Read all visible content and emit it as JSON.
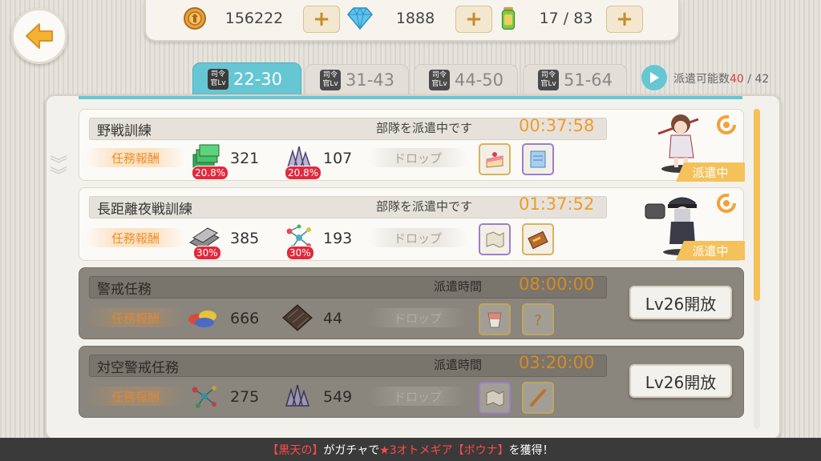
{
  "resources": [
    {
      "icon": "coin-icon",
      "value": "156222"
    },
    {
      "icon": "diamond-icon",
      "value": "1888"
    },
    {
      "icon": "stamina-icon",
      "value": "17 / 83"
    }
  ],
  "plus_label": "+",
  "tabs": [
    {
      "badge_top": "司令",
      "badge_bottom": "官Lv",
      "range": "22-30",
      "active": true
    },
    {
      "badge_top": "司令",
      "badge_bottom": "官Lv",
      "range": "31-43",
      "active": false
    },
    {
      "badge_top": "司令",
      "badge_bottom": "官Lv",
      "range": "44-50",
      "active": false
    },
    {
      "badge_top": "司令",
      "badge_bottom": "官Lv",
      "range": "51-64",
      "active": false
    }
  ],
  "dispatch": {
    "label": "派遣可能数",
    "current": "40",
    "total": " / 42"
  },
  "labels": {
    "reward": "任務報酬",
    "drop": "ドロップ"
  },
  "missions": [
    {
      "name": "野戦訓練",
      "status": "部隊を派遣中です",
      "time": "00:37:58",
      "rewards": [
        {
          "icon": "green-cash-icon",
          "value": "321",
          "bonus": "20.8%"
        },
        {
          "icon": "crystal-icon",
          "value": "107",
          "bonus": "20.8%"
        }
      ],
      "drops": [
        {
          "icon": "cake-icon"
        },
        {
          "icon": "scroll-icon"
        }
      ],
      "state": "派遣中"
    },
    {
      "name": "長距離夜戦訓練",
      "status": "部隊を派遣中です",
      "time": "01:37:52",
      "rewards": [
        {
          "icon": "steel-plate-icon",
          "value": "385",
          "bonus": "30%"
        },
        {
          "icon": "molecule-icon",
          "value": "193",
          "bonus": "30%"
        }
      ],
      "drops": [
        {
          "icon": "map-icon"
        },
        {
          "icon": "ammo-box-icon"
        }
      ],
      "state": "派遣中"
    },
    {
      "name": "警戒任務",
      "status": "派遣時間",
      "time": "08:00:00",
      "rewards": [
        {
          "icon": "fabric-icon",
          "value": "666"
        },
        {
          "icon": "dark-plate-icon",
          "value": "44"
        }
      ],
      "drops": [
        {
          "icon": "cup-icon"
        },
        {
          "icon": "mystery-icon"
        }
      ],
      "unlock": "Lv26開放"
    },
    {
      "name": "対空警戒任務",
      "status": "派遣時間",
      "time": "03:20:00",
      "rewards": [
        {
          "icon": "molecule-icon",
          "value": "275"
        },
        {
          "icon": "crystal-icon",
          "value": "549"
        }
      ],
      "drops": [
        {
          "icon": "map-icon"
        },
        {
          "icon": "stick-icon"
        }
      ],
      "unlock": "Lv26開放"
    }
  ],
  "ticker": {
    "p1": "【黒天の】",
    "p2": "がガチャで",
    "p3": "★3オトメギア【ボウナ】",
    "p4": "を獲得！"
  }
}
